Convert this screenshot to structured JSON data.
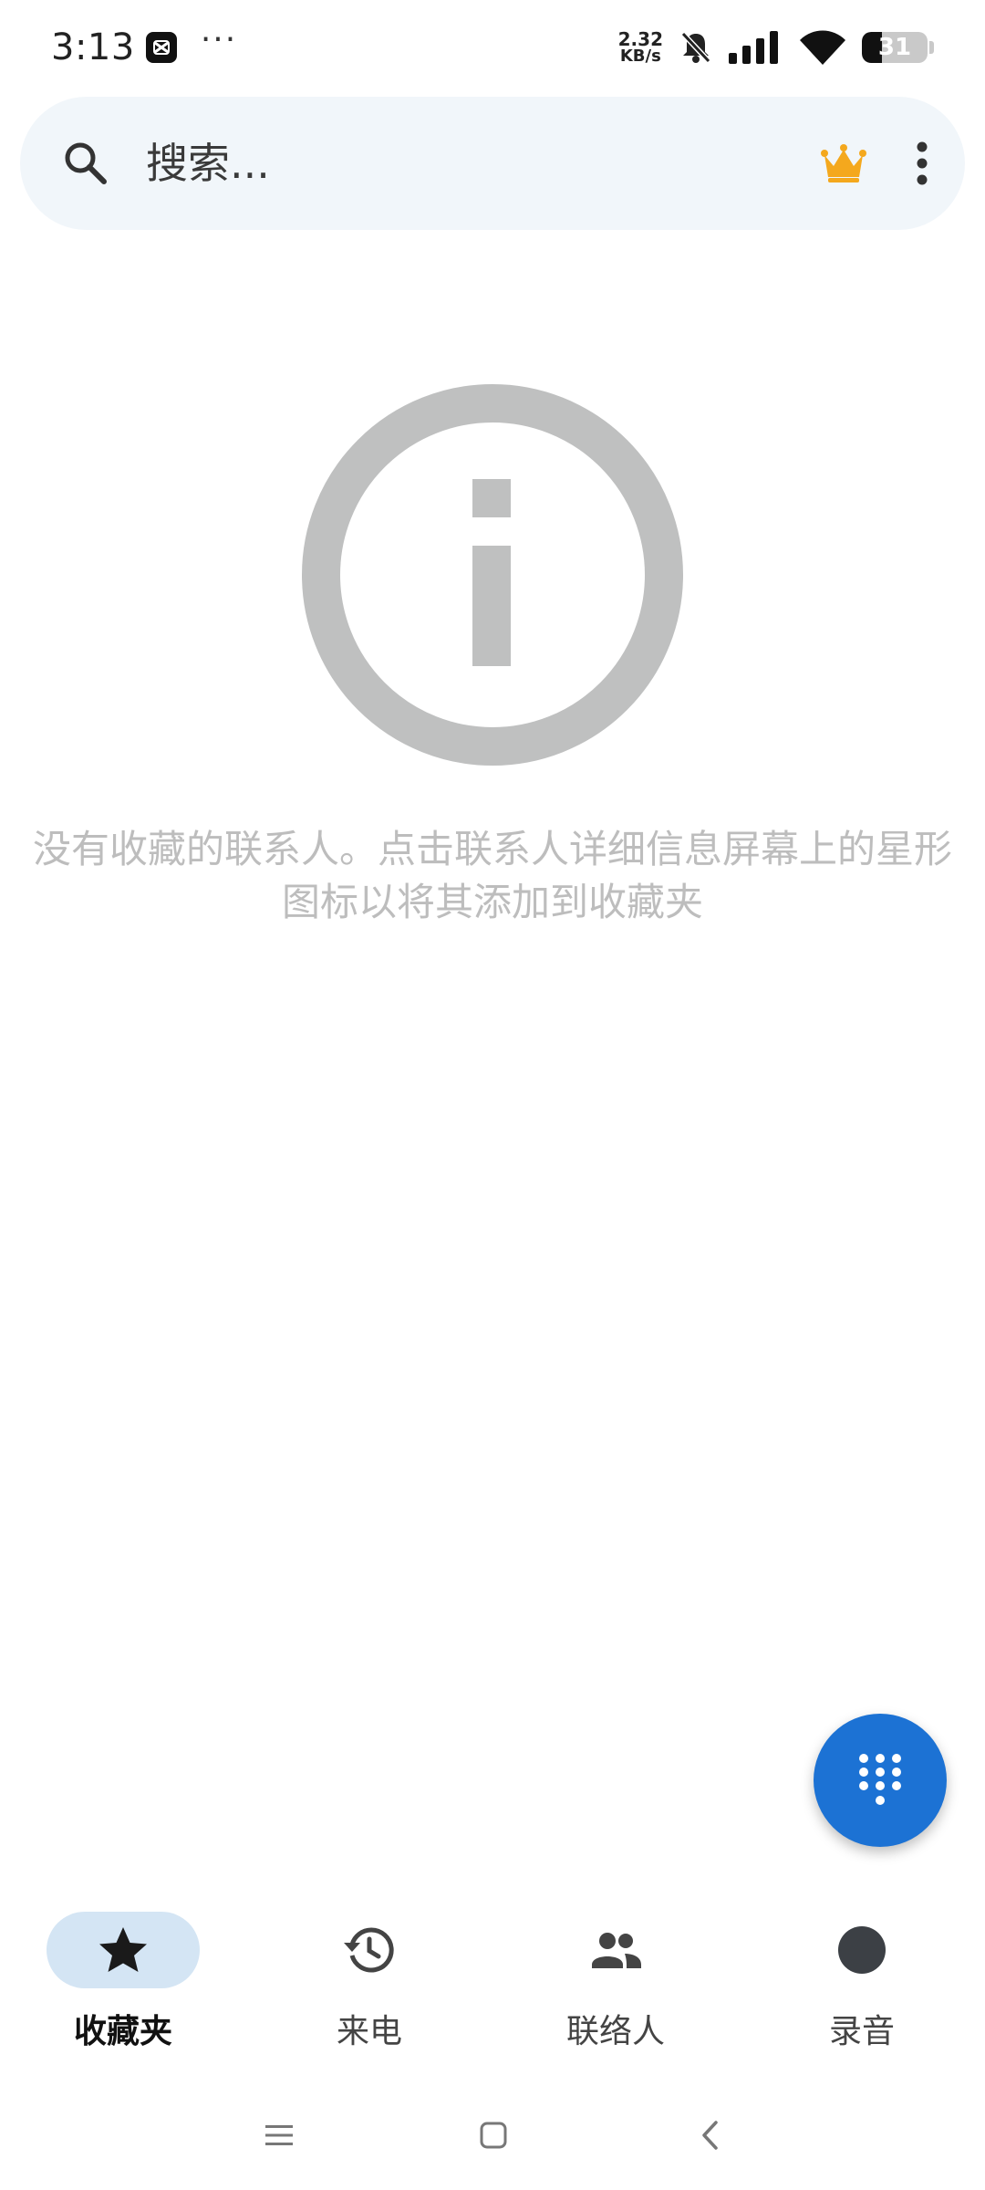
{
  "status_bar": {
    "time": "3:13",
    "more_dots": "···",
    "net_speed_value": "2.32",
    "net_speed_unit": "KB/s",
    "battery_level": "31",
    "battery_fraction": 0.31
  },
  "search": {
    "placeholder": "搜索..."
  },
  "empty_state": {
    "message": "没有收藏的联系人。点击联系人详细信息屏幕上的星形图标以将其添加到收藏夹"
  },
  "bottom_nav": {
    "items": [
      {
        "label": "收藏夹",
        "icon": "star-icon",
        "active": true
      },
      {
        "label": "来电",
        "icon": "history-icon",
        "active": false
      },
      {
        "label": "联络人",
        "icon": "people-icon",
        "active": false
      },
      {
        "label": "录音",
        "icon": "record-icon",
        "active": false
      }
    ]
  },
  "colors": {
    "accent": "#1c72d4",
    "search_background": "#f1f6fa",
    "active_tab": "#d4e5f4",
    "crown": "#f4a81d",
    "empty_icon": "#bfc0c0"
  }
}
